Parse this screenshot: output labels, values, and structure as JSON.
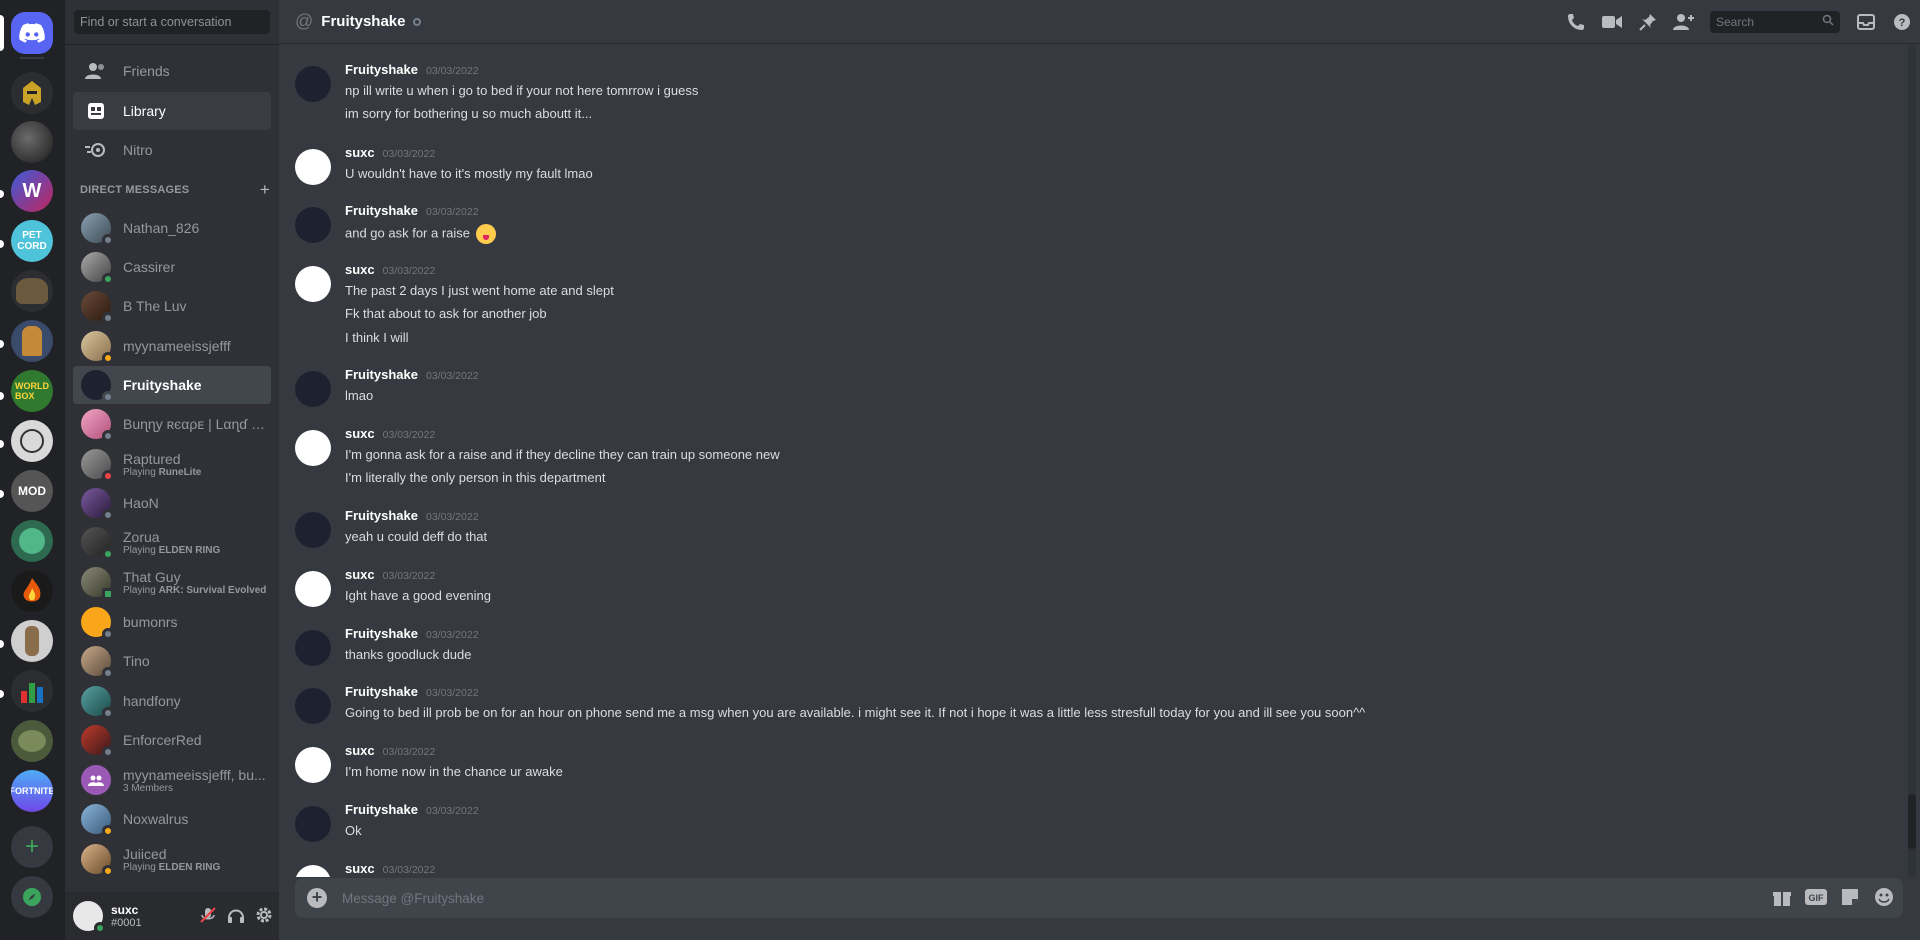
{
  "search": {
    "placeholder": "Find or start a conversation"
  },
  "nav": [
    {
      "label": "Friends",
      "icon": "friends-icon"
    },
    {
      "label": "Library",
      "icon": "library-icon",
      "active": true
    },
    {
      "label": "Nitro",
      "icon": "nitro-icon"
    }
  ],
  "dm_header": {
    "label": "DIRECT MESSAGES"
  },
  "dms": [
    {
      "name": "Nathan_826",
      "sub": "",
      "game": ""
    },
    {
      "name": "Cassirer",
      "sub": "",
      "game": ""
    },
    {
      "name": "B The Luv",
      "sub": "",
      "game": ""
    },
    {
      "name": "myynameeissjefff",
      "sub": "",
      "game": ""
    },
    {
      "name": "Fruityshake",
      "sub": "",
      "game": ""
    },
    {
      "name": "Buɳɳy ʀєαρᴇ | Lαɳɗ σ...",
      "sub": "",
      "game": ""
    },
    {
      "name": "Raptured",
      "sub": "Playing ",
      "game": "RuneLite"
    },
    {
      "name": "HaoN",
      "sub": "",
      "game": ""
    },
    {
      "name": "Zorua",
      "sub": "Playing ",
      "game": "ELDEN RING"
    },
    {
      "name": "That Guy",
      "sub": "Playing ",
      "game": "ARK: Survival Evolved"
    },
    {
      "name": "bumonrs",
      "sub": "",
      "game": ""
    },
    {
      "name": "Tino",
      "sub": "",
      "game": ""
    },
    {
      "name": "handfony",
      "sub": "",
      "game": ""
    },
    {
      "name": "EnforcerRed",
      "sub": "",
      "game": ""
    },
    {
      "name": "myynameeissjefff, bu...",
      "sub": "3 Members",
      "game": ""
    },
    {
      "name": "Noxwalrus",
      "sub": "",
      "game": ""
    },
    {
      "name": "Juiiced",
      "sub": "Playing ",
      "game": "ELDEN RING"
    }
  ],
  "user": {
    "name": "suxc",
    "tag": "#0001"
  },
  "channel": {
    "title": "Fruityshake"
  },
  "topbar": {
    "search_placeholder": "Search"
  },
  "messages": [
    {
      "author": "Fruityshake",
      "time": "03/03/2022",
      "lines": [
        "np ill write u when i go to bed if your not here tomrrow i guess",
        "im sorry for bothering u so much aboutt it..."
      ]
    },
    {
      "author": "suxc",
      "time": "03/03/2022",
      "lines": [
        "U wouldn't have to it's mostly my fault lmao"
      ]
    },
    {
      "author": "Fruityshake",
      "time": "03/03/2022",
      "lines": [
        "and go ask for a raise"
      ]
    },
    {
      "author": "suxc",
      "time": "03/03/2022",
      "lines": [
        "The past 2 days I just went home ate and slept",
        "Fk that about to ask for another job",
        "I think I will"
      ]
    },
    {
      "author": "Fruityshake",
      "time": "03/03/2022",
      "lines": [
        "lmao"
      ]
    },
    {
      "author": "suxc",
      "time": "03/03/2022",
      "lines": [
        "I'm gonna ask for a raise and if they decline they can train up someone new",
        "I'm literally the only person in this department"
      ]
    },
    {
      "author": "Fruityshake",
      "time": "03/03/2022",
      "lines": [
        "yeah u could deff do that"
      ]
    },
    {
      "author": "suxc",
      "time": "03/03/2022",
      "lines": [
        "Ight have a good evening"
      ]
    },
    {
      "author": "Fruityshake",
      "time": "03/03/2022",
      "lines": [
        "thanks goodluck dude"
      ]
    },
    {
      "author": "Fruityshake",
      "time": "03/03/2022",
      "lines": [
        "Going to bed ill prob be on for an hour on phone send me a msg when you are available. i might see it. If not i hope it was a little less stresfull today for you and ill see you soon^^"
      ]
    },
    {
      "author": "suxc",
      "time": "03/03/2022",
      "lines": [
        "I'm home now in the chance ur awake"
      ]
    },
    {
      "author": "Fruityshake",
      "time": "03/03/2022",
      "lines": [
        "Ok"
      ]
    },
    {
      "author": "suxc",
      "time": "03/03/2022",
      "lines": []
    }
  ],
  "composer": {
    "placeholder": "Message @Fruityshake"
  },
  "colors": {
    "brand": "#5865f2",
    "online": "#3ba55d",
    "idle": "#faa81a",
    "dnd": "#ed4245",
    "offline": "#747f8d"
  }
}
